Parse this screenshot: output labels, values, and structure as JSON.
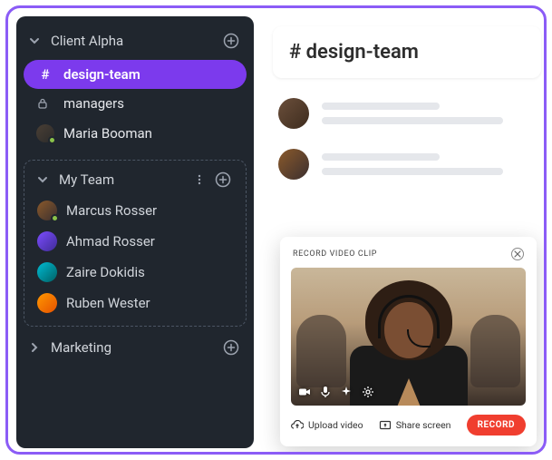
{
  "sidebar": {
    "sections": [
      {
        "title": "Client Alpha",
        "expanded": true,
        "items": [
          {
            "kind": "channel",
            "icon": "#",
            "label": "design-team",
            "active": true
          },
          {
            "kind": "channel",
            "icon": "lock",
            "label": "managers",
            "active": false
          },
          {
            "kind": "dm",
            "label": "Maria Booman",
            "presence": true
          }
        ]
      },
      {
        "title": "My Team",
        "expanded": true,
        "dashed": true,
        "members": [
          {
            "label": "Marcus Rosser",
            "presence": true
          },
          {
            "label": "Ahmad Rosser"
          },
          {
            "label": "Zaire Dokidis"
          },
          {
            "label": "Ruben Wester"
          }
        ]
      },
      {
        "title": "Marketing",
        "expanded": false
      }
    ]
  },
  "main": {
    "channel_prefix": "#",
    "channel_name": "design-team"
  },
  "recorder": {
    "title": "RECORD VIDEO CLIP",
    "upload_label": "Upload video",
    "share_label": "Share screen",
    "record_label": "RECORD"
  }
}
